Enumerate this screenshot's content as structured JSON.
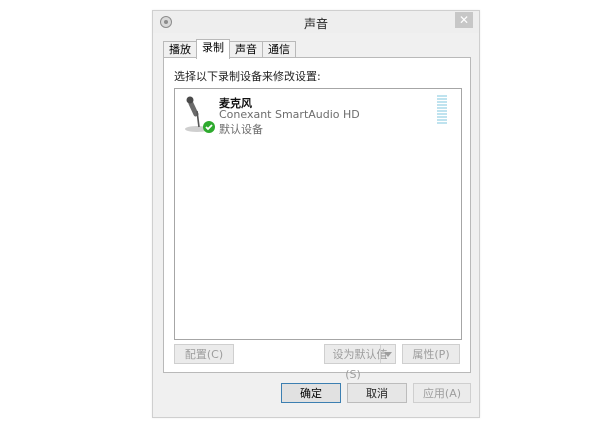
{
  "window": {
    "title": "声音",
    "close_glyph": "✕"
  },
  "tabs": [
    {
      "label": "播放",
      "active": false
    },
    {
      "label": "录制",
      "active": true
    },
    {
      "label": "声音",
      "active": false
    },
    {
      "label": "通信",
      "active": false
    }
  ],
  "recording": {
    "instruction": "选择以下录制设备来修改设置:",
    "devices": [
      {
        "name": "麦克风",
        "driver": "Conexant SmartAudio HD",
        "status": "默认设备",
        "icon": "microphone-icon",
        "badge_icon": "green-check-icon"
      }
    ]
  },
  "panel_buttons": {
    "configure": "配置(C)",
    "set_default": "设为默认值(S)",
    "properties": "属性(P)"
  },
  "dialog_buttons": {
    "ok": "确定",
    "cancel": "取消",
    "apply": "应用(A)"
  },
  "colors": {
    "accent_border": "#3c7fb1",
    "level_meter": "#bfe3ef",
    "check_green": "#2eaa2e"
  }
}
